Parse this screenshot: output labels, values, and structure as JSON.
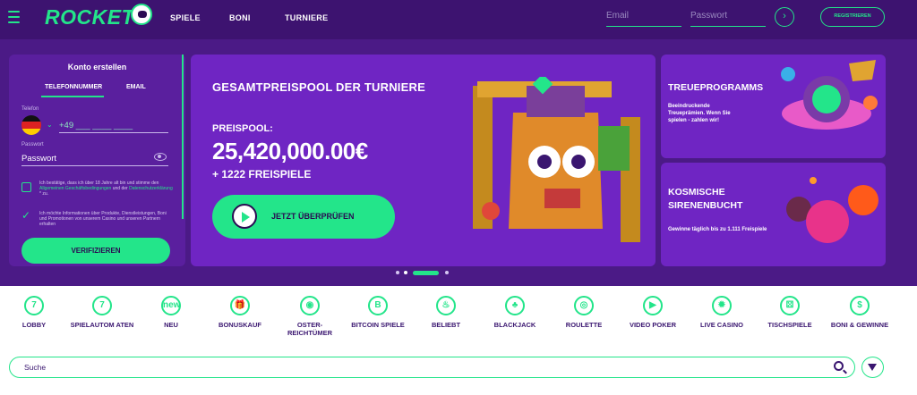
{
  "header": {
    "logo": "ROCKET",
    "nav": [
      "SPIELE",
      "BONI",
      "TURNIERE"
    ],
    "email_placeholder": "Email",
    "password_placeholder": "Passwort",
    "submit_icon": "chevron-right-icon",
    "register_label": "REGISTRIEREN"
  },
  "registration": {
    "title": "Konto erstellen",
    "tabs": [
      "TELEFONNUMMER",
      "EMAIL"
    ],
    "active_tab": "TELEFONNUMMER",
    "phone_label": "Telefon",
    "country_code": "+49",
    "phone_placeholder": "___ ____ ____",
    "password_label": "Passwort",
    "password_placeholder": "Passwort",
    "terms_text_1": "Ich bestätige, dass ich über 18 Jahre alt bin und stimme den",
    "terms_link_1": "Allgemeinen Geschäftsbedingungen",
    "terms_text_2": "und der",
    "terms_link_2": "Datenschutzerklärung",
    "terms_text_3": "* zu.",
    "marketing_text": "Ich möchte Informationen über Produkte, Dienstleistungen, Boni und Promotionen von unserem Casino und unseren Partnern erhalten",
    "verify_label": "VERIFIZIEREN"
  },
  "hero": {
    "title": "GESAMTPREISPOOL DER TURNIERE",
    "pool_label": "PREISPOOL:",
    "amount": "25,420,000.00€",
    "freespins": "+ 1222 FREISPIELE",
    "cta": "JETZT ÜBERPRÜFEN",
    "slide_count": 4,
    "active_slide": 3
  },
  "cards": [
    {
      "title": "TREUEPROGRAMMS",
      "desc": "Beeindruckende Treueprämien. Wenn Sie spielen - zahlen wir!"
    },
    {
      "title": "KOSMISCHE SIRENENBUCHT",
      "desc": "Gewinne täglich bis zu 1.111 Freispiele"
    }
  ],
  "categories": [
    {
      "label": "LOBBY",
      "icon": "lobby-icon",
      "glyph": "7"
    },
    {
      "label": "SPIELAUTOM ATEN",
      "icon": "slots-icon",
      "glyph": "7"
    },
    {
      "label": "NEU",
      "icon": "new-icon",
      "glyph": "new"
    },
    {
      "label": "BONUSKAUF",
      "icon": "gift-icon",
      "glyph": "🎁"
    },
    {
      "label": "OSTER- REICHTÜMER",
      "icon": "easter-egg-icon",
      "glyph": "◉"
    },
    {
      "label": "BITCOIN SPIELE",
      "icon": "bitcoin-icon",
      "glyph": "B"
    },
    {
      "label": "BELIEBT",
      "icon": "fire-icon",
      "glyph": "♨"
    },
    {
      "label": "BLACKJACK",
      "icon": "clubs-icon",
      "glyph": "♣"
    },
    {
      "label": "ROULETTE",
      "icon": "roulette-icon",
      "glyph": "◎"
    },
    {
      "label": "VIDEO POKER",
      "icon": "play-icon",
      "glyph": "▶"
    },
    {
      "label": "LIVE CASINO",
      "icon": "live-icon",
      "glyph": "✹"
    },
    {
      "label": "TISCHSPIELE",
      "icon": "dice-icon",
      "glyph": "⚄"
    },
    {
      "label": "BONI & GEWINNE",
      "icon": "bonus-icon",
      "glyph": "$"
    }
  ],
  "search": {
    "placeholder": "Suche"
  },
  "colors": {
    "accent": "#23e58a",
    "background": "#4b1a86",
    "header": "#3d1370",
    "card": "#6f25c3"
  }
}
